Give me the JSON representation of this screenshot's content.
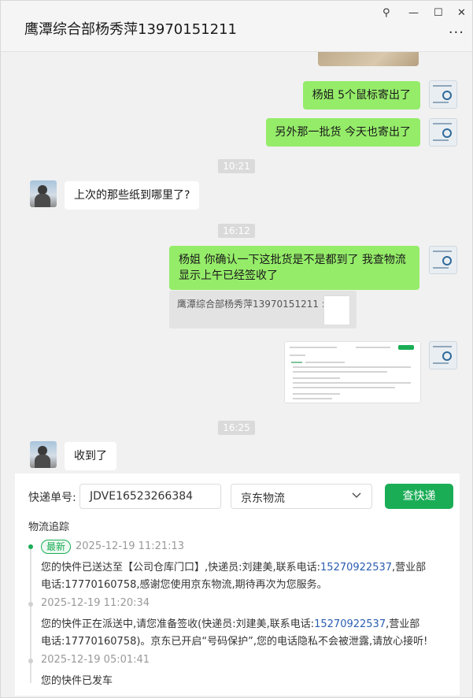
{
  "window": {
    "title": "鹰潭综合部杨秀萍13970151211",
    "pin_glyph": "⚲",
    "min_glyph": "—",
    "max_glyph": "☐",
    "close_glyph": "✕",
    "more_glyph": "···"
  },
  "chat": {
    "msg1": "杨姐 5个鼠标寄出了",
    "msg2": "另外那一批货 今天也寄出了",
    "time1": "10:21",
    "msg3": "上次的那些纸到哪里了?",
    "time2": "16:12",
    "msg4_line1": "杨姐   你确认一下这批货是不是都到了  我查物流",
    "msg4_line2": "显示上午已经签收了",
    "quote_text": "鹰潭综合部杨秀萍13970151211 :",
    "time3": "16:25",
    "msg5": "收到了"
  },
  "tracking": {
    "number_label": "快递单号:",
    "number_value": "JDVE16523266384",
    "carrier": "京东物流",
    "query_button": "查快递",
    "section_title": "物流追踪",
    "latest_badge": "最新",
    "events": [
      {
        "time": "2025-12-19 11:21:13",
        "line1a": "您的快件已送达至【公司仓库门口】,快递员:刘建美,联系电话:",
        "phone": "15270922537",
        "line1b": ",营业部",
        "line2": "电话:17770160758,感谢您使用京东物流,期待再次为您服务。"
      },
      {
        "time": "2025-12-19 11:20:34",
        "line1a": "您的快件正在派送中,请您准备签收(快递员:刘建美,联系电话:",
        "phone": "15270922537",
        "line1b": ",营业部",
        "line2": "电话:17770160758)。京东已开启“号码保护”,您的电话隐私不会被泄露,请放心接听!"
      },
      {
        "time": "2025-12-19 05:01:41",
        "line1a": "您的快件已发车"
      }
    ]
  }
}
